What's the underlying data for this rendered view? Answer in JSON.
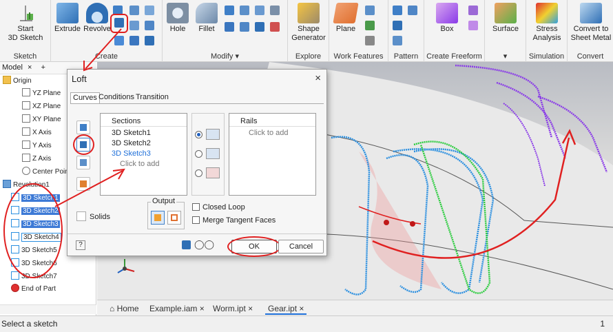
{
  "ribbon": {
    "groups": [
      {
        "label": "Sketch",
        "buttons": [
          "Start\n3D Sketch"
        ]
      },
      {
        "label": "Create",
        "buttons": [
          "Extrude",
          "Revolve"
        ]
      },
      {
        "label": "Modify",
        "buttons": [
          "Hole",
          "Fillet"
        ]
      },
      {
        "label": "Explore",
        "buttons": [
          "Shape\nGenerator"
        ]
      },
      {
        "label": "Work Features",
        "buttons": [
          "Plane"
        ]
      },
      {
        "label": "Pattern",
        "buttons": []
      },
      {
        "label": "Create Freeform",
        "buttons": [
          "Box"
        ]
      },
      {
        "label": "",
        "buttons": [
          "Surface"
        ]
      },
      {
        "label": "Simulation",
        "buttons": [
          "Stress\nAnalysis"
        ]
      },
      {
        "label": "Convert",
        "buttons": [
          "Convert to\nSheet Metal"
        ]
      }
    ],
    "start_sketch": "Start",
    "start_sketch2": "3D Sketch",
    "extrude": "Extrude",
    "revolve": "Revolve",
    "hole": "Hole",
    "fillet": "Fillet",
    "shape_gen": "Shape",
    "shape_gen2": "Generator",
    "plane": "Plane",
    "box": "Box",
    "surface": "Surface",
    "stress": "Stress",
    "stress2": "Analysis",
    "convert": "Convert to",
    "convert2": "Sheet Metal",
    "grp_sketch": "Sketch",
    "grp_create": "Create",
    "grp_modify": "Modify ▾",
    "grp_explore": "Explore",
    "grp_work": "Work Features",
    "grp_pattern": "Pattern",
    "grp_freeform": "Create Freeform",
    "grp_surface": "▾",
    "grp_sim": "Simulation",
    "grp_convert": "Convert"
  },
  "browser": {
    "tab": "Model",
    "close": "×",
    "add": "+",
    "nodes": [
      {
        "label": "Origin"
      },
      {
        "label": "YZ Plane"
      },
      {
        "label": "XZ Plane"
      },
      {
        "label": "XY Plane"
      },
      {
        "label": "X Axis"
      },
      {
        "label": "Y Axis"
      },
      {
        "label": "Z Axis"
      },
      {
        "label": "Center Point"
      },
      {
        "label": "Revolution1"
      },
      {
        "label": "3D Sketch1"
      },
      {
        "label": "3D Sketch2"
      },
      {
        "label": "3D Sketch3"
      },
      {
        "label": "3D Sketch4"
      },
      {
        "label": "3D Sketch5"
      },
      {
        "label": "3D Sketch6"
      },
      {
        "label": "3D Sketch7"
      },
      {
        "label": "End of Part"
      }
    ]
  },
  "dialog": {
    "title": "Loft",
    "close": "×",
    "tabs": [
      "Curves",
      "Conditions",
      "Transition"
    ],
    "sections_header": "Sections",
    "sections": [
      "3D Sketch1",
      "3D Sketch2",
      "3D Sketch3"
    ],
    "sections_click": "Click to add",
    "rails_header": "Rails",
    "rails_click": "Click to add",
    "solids": "Solids",
    "output": "Output",
    "closed_loop": "Closed Loop",
    "merge_tangent": "Merge Tangent Faces",
    "ok": "OK",
    "cancel": "Cancel",
    "help": "?"
  },
  "doc_tabs": {
    "home": "Home",
    "t1": "Example.iam",
    "t2": "Worm.ipt",
    "t3": "Gear.ipt",
    "x": "×"
  },
  "status": {
    "text": "Select a sketch",
    "count": "1"
  },
  "colors": {
    "accent": "#1e6fd9",
    "annotation_red": "#e02020",
    "sketch_blue": "#2a8fe0",
    "sketch_green": "#2ecc40",
    "sketch_purple": "#8a3be8"
  }
}
